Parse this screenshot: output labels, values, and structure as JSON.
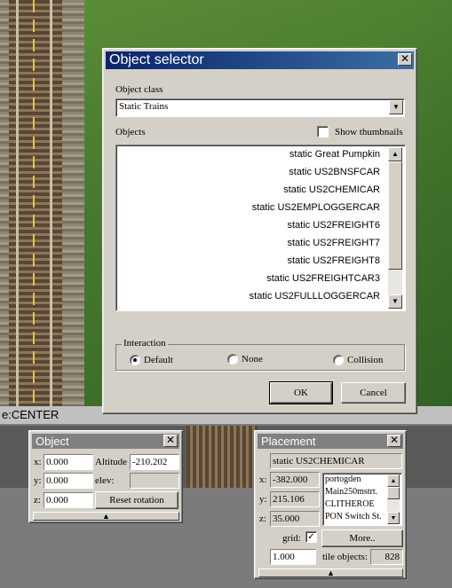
{
  "status_bar": {
    "text": "e:CENTER"
  },
  "object_selector": {
    "title": "Object selector",
    "object_class_label": "Object class",
    "object_class_value": "Static Trains",
    "objects_label": "Objects",
    "show_thumbnails_label": "Show thumbnails",
    "show_thumbnails_checked": false,
    "objects": [
      "static Great Pumpkin",
      "static US2BNSFCAR",
      "static US2CHEMICAR",
      "static US2EMPLOGGERCAR",
      "static US2FREIGHT6",
      "static US2FREIGHT7",
      "static US2FREIGHT8",
      "static US2FREIGHTCAR3",
      "static US2FULLLOGGERCAR"
    ],
    "interaction": {
      "title": "Interaction",
      "options": [
        "Default",
        "None",
        "Collision"
      ],
      "selected": "Default"
    },
    "ok_label": "OK",
    "cancel_label": "Cancel"
  },
  "object_panel": {
    "title": "Object",
    "x_label": "x:",
    "x_value": "0.000",
    "y_label": "y:",
    "y_value": "0.000",
    "z_label": "z:",
    "z_value": "0.000",
    "altitude_label": "Altitude",
    "altitude_value": "-210.202",
    "elev_label": "elev:",
    "reset_rotation_label": "Reset rotation"
  },
  "placement_panel": {
    "title": "Placement",
    "selected_object": "static US2CHEMICAR",
    "x_label": "x:",
    "x_value": "-382.000",
    "y_label": "y:",
    "y_value": "215.106",
    "z_label": "z:",
    "z_value": "35.000",
    "list_items": [
      "portogden",
      "Main250mstrt.",
      "CLITHEROE",
      "PON Switch St."
    ],
    "grid_label": "grid:",
    "grid_checked": true,
    "more_label": "More..",
    "grid_value": "1.000",
    "tile_objects_label": "tile objects:",
    "tile_objects_value": "828"
  },
  "colors": {
    "titlebar_active": "#0a246a",
    "titlebar_inactive": "#808080",
    "window_face": "#d4d0c8"
  },
  "icons": [
    "close-icon",
    "dropdown-arrow-icon",
    "scroll-up-icon",
    "scroll-down-icon",
    "collapse-arrow-icon",
    "check-icon"
  ]
}
